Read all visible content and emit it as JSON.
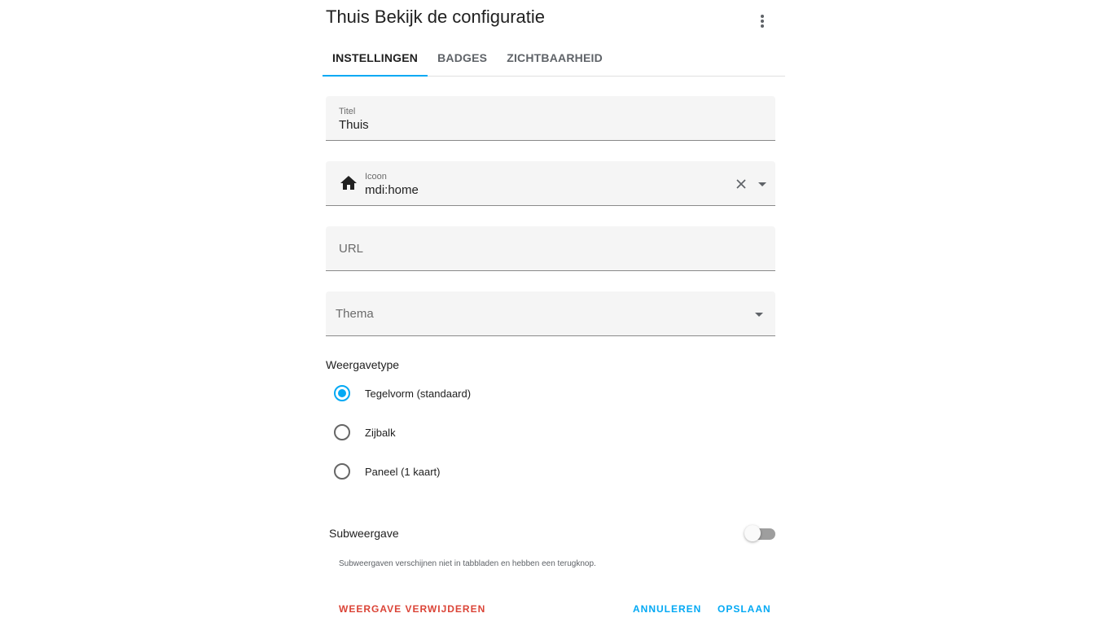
{
  "dialog": {
    "title": "Thuis Bekijk de configuratie",
    "menu_icon": "dots-vertical-icon"
  },
  "tabs": [
    {
      "label": "INSTELLINGEN",
      "active": true
    },
    {
      "label": "BADGES",
      "active": false
    },
    {
      "label": "ZICHTBAARHEID",
      "active": false
    }
  ],
  "form": {
    "title": {
      "label": "Titel",
      "value": "Thuis"
    },
    "icon": {
      "label": "Icoon",
      "value": "mdi:home",
      "icon": "home-icon"
    },
    "url": {
      "label": "URL",
      "value": ""
    },
    "theme": {
      "label": "Thema",
      "value": ""
    }
  },
  "view_type": {
    "label": "Weergavetype",
    "options": [
      {
        "label": "Tegelvorm (standaard)",
        "selected": true
      },
      {
        "label": "Zijbalk",
        "selected": false
      },
      {
        "label": "Paneel (1 kaart)",
        "selected": false
      }
    ]
  },
  "subview": {
    "label": "Subweergave",
    "enabled": false,
    "helper": "Subweergaven verschijnen niet in tabbladen en hebben een terugknop."
  },
  "actions": {
    "delete": "WEERGAVE VERWIJDEREN",
    "cancel": "ANNULEREN",
    "save": "OPSLAAN"
  },
  "colors": {
    "accent": "#03a9f4",
    "danger": "#db4437"
  }
}
